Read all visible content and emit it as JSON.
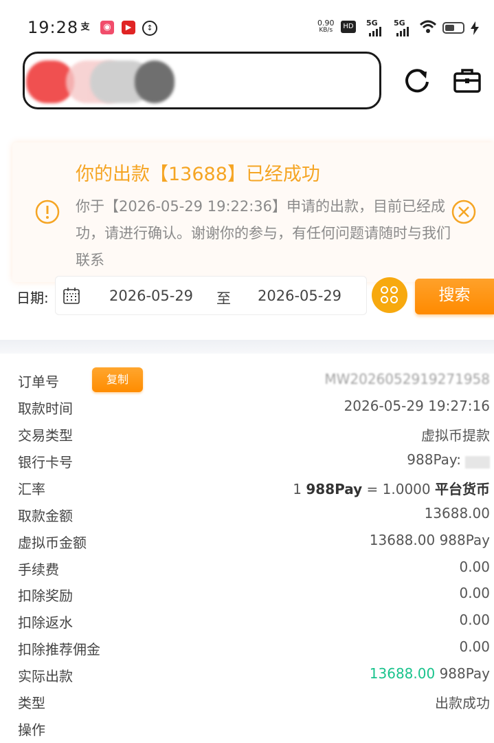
{
  "status_bar": {
    "time": "19:28",
    "net_speed": "0.90",
    "net_unit": "KB/s",
    "sim1": "5G",
    "sim2": "5G",
    "battery_level": 0.55
  },
  "notice": {
    "title": "你的出款【13688】已经成功",
    "body": "你于【2026-05-29 19:22:36】申请的出款，目前已经成功，请进行确认。谢谢你的参与，有任何问题请随时与我们联系",
    "colors": {
      "title": "#f5a524",
      "body": "#8a8a8a"
    }
  },
  "filter": {
    "date_label": "日期:",
    "start_date": "2026-05-29",
    "to_label": "至",
    "end_date": "2026-05-29",
    "search_label": "搜索"
  },
  "details": {
    "copy_label": "复制",
    "rows": [
      {
        "label": "订单号",
        "value": "MW2026052919271958"
      },
      {
        "label": "取款时间",
        "value": "2026-05-29 19:27:16"
      },
      {
        "label": "交易类型",
        "value": "虚拟币提款"
      },
      {
        "label": "银行卡号",
        "value": "988Pay:"
      },
      {
        "label": "汇率",
        "rate_prefix": "1",
        "rate_coin": "988Pay",
        "rate_eq": "= 1.0000",
        "rate_target": "平台货币"
      },
      {
        "label": "取款金额",
        "value": "13688.00"
      },
      {
        "label": "虚拟币金额",
        "value": "13688.00 988Pay"
      },
      {
        "label": "手续费",
        "value": "0.00"
      },
      {
        "label": "扣除奖励",
        "value": "0.00"
      },
      {
        "label": "扣除返水",
        "value": "0.00"
      },
      {
        "label": "扣除推荐佣金",
        "value": "0.00"
      },
      {
        "label": "实际出款",
        "amount": "13688.00",
        "unit": "988Pay"
      },
      {
        "label": "类型",
        "value": "出款成功"
      },
      {
        "label": "操作",
        "value": ""
      }
    ]
  },
  "colors": {
    "accent": "#ff8c00",
    "success": "#19c38c"
  }
}
